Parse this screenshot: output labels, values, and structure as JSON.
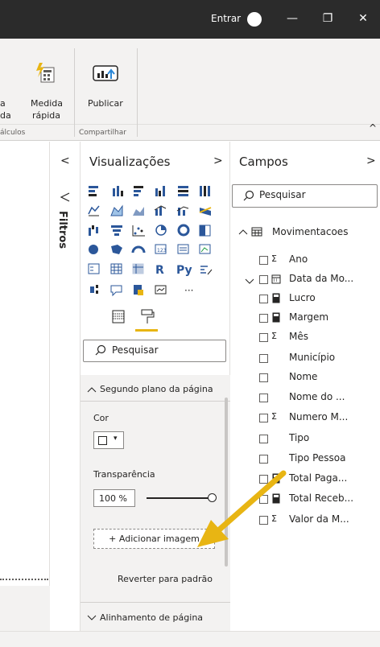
{
  "titlebar": {
    "signin": "Entrar",
    "minimize": "—",
    "restore": "❐",
    "close": "✕"
  },
  "ribbon": {
    "quick_measure_line1": "Medida",
    "quick_measure_line2": "rápida",
    "left_cut_1": "a",
    "left_cut_2": "da",
    "publish": "Publicar",
    "group_calc": "álculos",
    "group_share": "Compartilhar"
  },
  "filters": {
    "label": "Filtros",
    "collapse": "<"
  },
  "visualizations": {
    "title": "Visualizações",
    "expand": ">",
    "search_placeholder": "Pesquisar",
    "section_background": "Segundo plano da página",
    "color_label": "Cor",
    "transparency_label": "Transparência",
    "transparency_value": "100 %",
    "add_image": "+ Adicionar imagem",
    "revert": "Reverter para padrão",
    "section_alignment": "Alinhamento de página",
    "more": "···",
    "r_icon": "R",
    "py_icon": "Py"
  },
  "fields": {
    "title": "Campos",
    "expand": ">",
    "search_placeholder": "Pesquisar",
    "table_name": "Movimentacoes",
    "items": [
      {
        "icon": "Σ",
        "label": "Ano"
      },
      {
        "icon": "▦",
        "label": "Data da Mo..."
      },
      {
        "icon": "▦",
        "label": "Lucro"
      },
      {
        "icon": "▦",
        "label": "Margem"
      },
      {
        "icon": "Σ",
        "label": "Mês"
      },
      {
        "icon": "",
        "label": "Município"
      },
      {
        "icon": "",
        "label": "Nome"
      },
      {
        "icon": "",
        "label": "Nome do ..."
      },
      {
        "icon": "Σ",
        "label": "Numero M..."
      },
      {
        "icon": "",
        "label": "Tipo"
      },
      {
        "icon": "",
        "label": "Tipo Pessoa"
      },
      {
        "icon": "▦",
        "label": "Total Paga..."
      },
      {
        "icon": "▦",
        "label": "Total Receb..."
      },
      {
        "icon": "Σ",
        "label": "Valor da M..."
      }
    ]
  },
  "colors": {
    "accent_yellow": "#e8b513",
    "titlebar": "#2b2b2b"
  }
}
